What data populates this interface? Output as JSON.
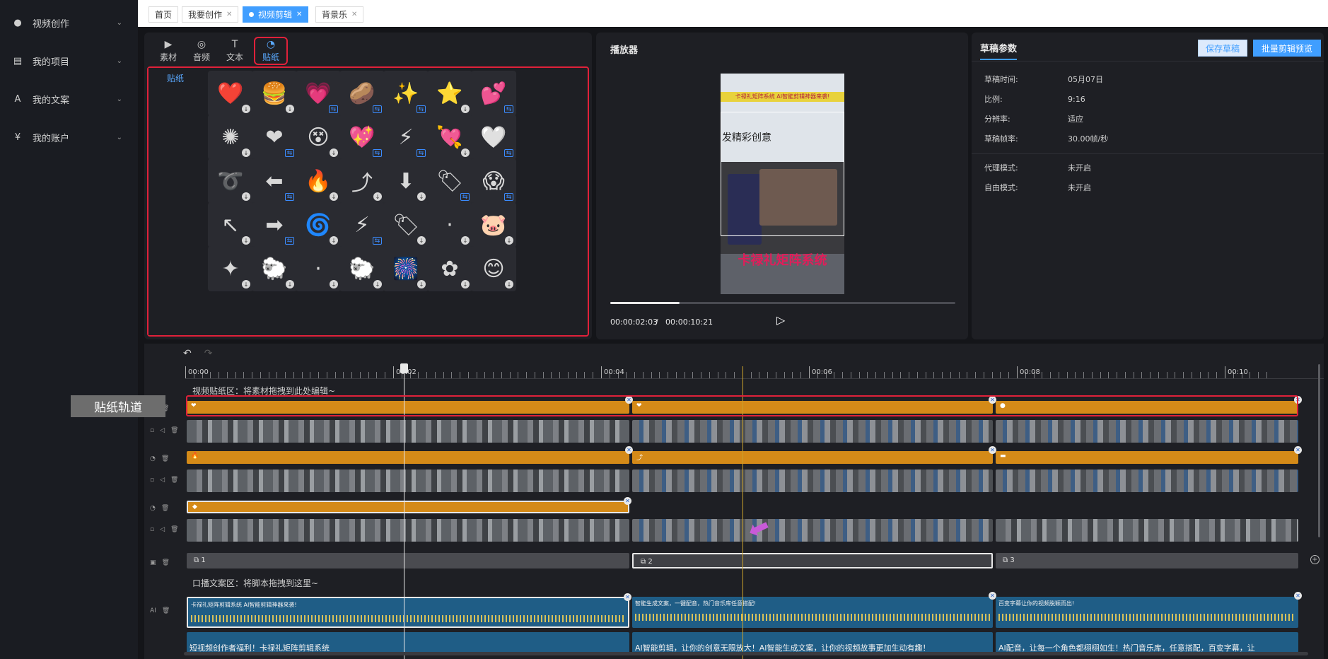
{
  "sidebar": {
    "items": [
      {
        "label": "视频创作",
        "icon": "globe-icon"
      },
      {
        "label": "我的项目",
        "icon": "document-icon"
      },
      {
        "label": "我的文案",
        "icon": "text-image-icon"
      },
      {
        "label": "我的账户",
        "icon": "yen-icon"
      }
    ]
  },
  "tabs": [
    {
      "label": "首页",
      "closable": false
    },
    {
      "label": "我要创作",
      "closable": true
    },
    {
      "label": "视频剪辑",
      "closable": true,
      "active": true
    },
    {
      "label": "背景乐",
      "closable": true
    }
  ],
  "media_tabs": [
    {
      "label": "素材",
      "icon": "play-square-icon"
    },
    {
      "label": "音频",
      "icon": "music-disc-icon"
    },
    {
      "label": "文本",
      "icon": "text-box-icon"
    },
    {
      "label": "贴纸",
      "icon": "sticker-icon",
      "active": true
    }
  ],
  "sticker_category": "贴纸",
  "stickers": [
    "❤️",
    "🍔",
    "💗",
    "🥔",
    "✨",
    "⭐",
    "💕",
    "✺",
    "❤",
    "😵",
    "💖",
    "⚡",
    "💘",
    "🤍",
    "➰",
    "⬅",
    "🔥",
    "⤴",
    "⬇",
    "🏷",
    "😱",
    "↖",
    "➡",
    "🌀",
    "⚡",
    "🏷",
    "·",
    "🐷",
    "✦",
    "🐑",
    "·",
    "🐑",
    "🎆",
    "✿",
    "😊"
  ],
  "player": {
    "title": "播放器",
    "video_banner": "卡禄礼矩阵系统 AI智能剪辑神器来袭!",
    "video_text1": "发精彩创意",
    "video_text2": "卡禄礼矩阵系统",
    "progress": 0.2,
    "current_time": "00:00:02:03",
    "separator": "/",
    "total_time": "00:00:10:21",
    "play_icon": "play-icon"
  },
  "props": {
    "title": "草稿参数",
    "save_label": "保存草稿",
    "batch_label": "批量剪辑预览",
    "accent": "#409eff",
    "rows": [
      {
        "k": "草稿时间:",
        "v": "05月07日"
      },
      {
        "k": "比例:",
        "v": "9:16"
      },
      {
        "k": "分辨率:",
        "v": "适应"
      },
      {
        "k": "草稿帧率:",
        "v": "30.00帧/秒"
      },
      {
        "k": "代理模式:",
        "v": "未开启"
      },
      {
        "k": "自由模式:",
        "v": "未开启"
      }
    ]
  },
  "timeline": {
    "undo_icon": "undo-icon",
    "redo_icon": "redo-icon",
    "ruler": [
      "00:00",
      "00:02",
      "00:04",
      "00:06",
      "00:08",
      "00:10"
    ],
    "sticker_zone": "视频贴纸区：将素材拖拽到此处编辑~",
    "script_zone": "口播文案区：将脚本拖拽到这里~",
    "sticker_track_label": "贴纸轨道",
    "segments": [
      "1",
      "2",
      "3"
    ],
    "audio_titles": [
      "卡禄礼矩阵剪辑系统 AI智能剪辑神器来袭!",
      "智能生成文案，一键配音，热门音乐库任意搭配!",
      "百变字幕让你的视频脱颖而出!"
    ],
    "audio2_titles": [
      "短视频创作者福利！卡禄礼矩阵剪辑系统",
      "AI智能剪辑，让你的创意无限放大！AI智能生成文案，让你的视频故事更加生动有趣！",
      "AI配音，让每一个角色都栩栩如生！热门音乐库，任意搭配，百变字幕，让"
    ],
    "orange": "#d48a18",
    "highlight": "#e0213a"
  }
}
